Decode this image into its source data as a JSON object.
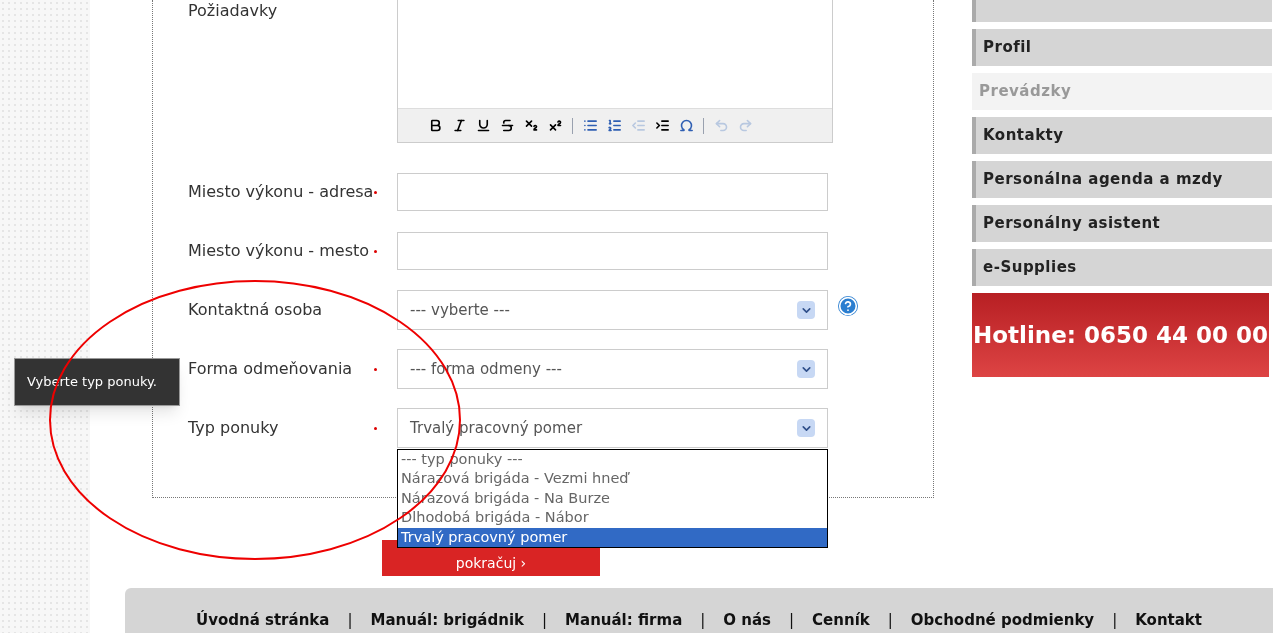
{
  "form": {
    "textarea_label": "Požiadavky",
    "toolbar": [
      {
        "kind": "bold",
        "disabled": false
      },
      {
        "kind": "italic",
        "disabled": false
      },
      {
        "kind": "underline",
        "disabled": false
      },
      {
        "kind": "strike",
        "disabled": false
      },
      {
        "kind": "subscript",
        "disabled": false
      },
      {
        "kind": "superscript",
        "disabled": false
      },
      {
        "kind": "divider"
      },
      {
        "kind": "bullets",
        "disabled": false
      },
      {
        "kind": "numbers",
        "disabled": false
      },
      {
        "kind": "outdent",
        "disabled": true
      },
      {
        "kind": "indent",
        "disabled": false
      },
      {
        "kind": "symbol",
        "disabled": false
      },
      {
        "kind": "divider"
      },
      {
        "kind": "undo",
        "disabled": true
      },
      {
        "kind": "redo",
        "disabled": true
      }
    ],
    "fields": [
      {
        "kind": "input",
        "label": "Miesto výkonu - adresa",
        "required": true
      },
      {
        "kind": "input",
        "label": "Miesto výkonu - mesto",
        "required": true
      },
      {
        "kind": "select",
        "label": "Kontaktná osoba",
        "required": false,
        "value": "--- vyberte ---",
        "help": true,
        "open": false
      },
      {
        "kind": "select",
        "label": "Forma odmeňovania",
        "required": true,
        "value": "--- forma odmeny ---",
        "help": false,
        "open": false
      },
      {
        "kind": "select",
        "label": "Typ ponuky",
        "required": true,
        "value": "Trvalý pracovný pomer",
        "help": false,
        "open": true,
        "options": [
          {
            "label": "--- typ ponuky ---",
            "selected": false
          },
          {
            "label": "Nárazová brigáda - Vezmi hneď",
            "selected": false
          },
          {
            "label": "Nárazová brigáda - Na Burze",
            "selected": false
          },
          {
            "label": "Dlhodobá brigáda - Nábor",
            "selected": false
          },
          {
            "label": "Trvalý pracovný pomer",
            "selected": true
          }
        ]
      }
    ],
    "submit": "pokračuj ›",
    "tooltip": "Vyberte typ ponuky."
  },
  "sidebar": {
    "items": [
      {
        "label": "Profil",
        "selected": false
      },
      {
        "label": "Prevádzky",
        "selected": true
      },
      {
        "label": "Kontakty",
        "selected": false
      },
      {
        "label": "Personálna agenda a mzdy",
        "selected": false
      },
      {
        "label": "Personálny asistent",
        "selected": false
      },
      {
        "label": "e-Supplies",
        "selected": false
      }
    ],
    "hotline": "Hotline: 0650 44 00 00"
  },
  "footer": {
    "separator": "|",
    "links": [
      "Úvodná stránka",
      "Manuál: brigádnik",
      "Manuál: firma",
      "O nás",
      "Cenník",
      "Obchodné podmienky",
      "Kontakt"
    ]
  }
}
